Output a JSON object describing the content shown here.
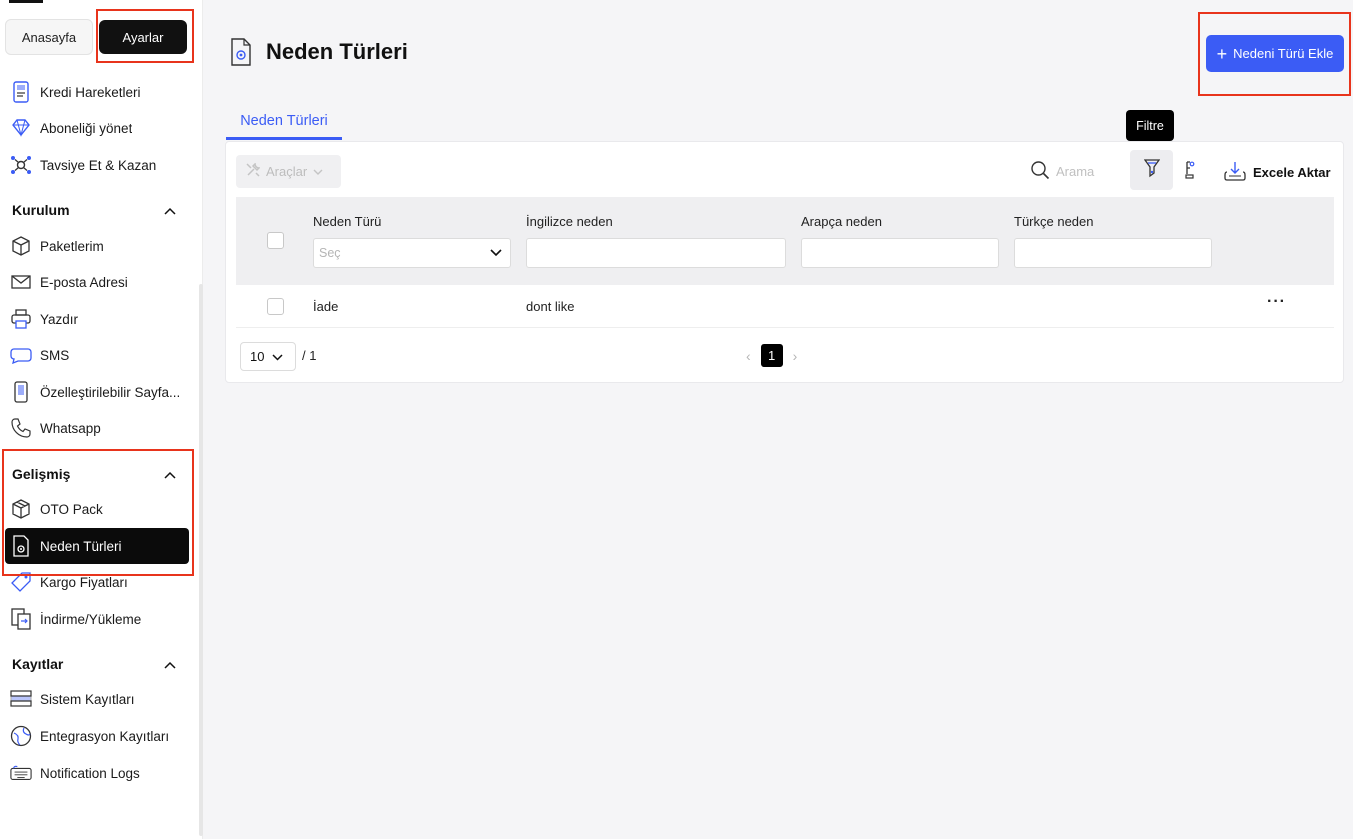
{
  "sidebar": {
    "home_label": "Anasayfa",
    "settings_label": "Ayarlar",
    "top_items": [
      {
        "label": "Kredi Hareketleri",
        "icon": "credit-card-icon"
      },
      {
        "label": "Aboneliği yönet",
        "icon": "diamond-icon"
      },
      {
        "label": "Tavsiye Et & Kazan",
        "icon": "network-icon"
      }
    ],
    "sections": [
      {
        "title": "Kurulum",
        "items": [
          {
            "label": "Paketlerim",
            "icon": "box-icon"
          },
          {
            "label": "E-posta Adresi",
            "icon": "mail-icon"
          },
          {
            "label": "Yazdır",
            "icon": "printer-icon"
          },
          {
            "label": "SMS",
            "icon": "chat-icon"
          },
          {
            "label": "Özelleştirilebilir Sayfa...",
            "icon": "phone-page-icon"
          },
          {
            "label": "Whatsapp",
            "icon": "phone-icon"
          }
        ]
      },
      {
        "title": "Gelişmiş",
        "items": [
          {
            "label": "OTO Pack",
            "icon": "package-icon"
          },
          {
            "label": "Neden Türleri",
            "icon": "document-gear-icon",
            "active": true
          },
          {
            "label": "Kargo Fiyatları",
            "icon": "tag-icon"
          },
          {
            "label": "İndirme/Yükleme",
            "icon": "transfer-icon"
          }
        ]
      },
      {
        "title": "Kayıtlar",
        "items": [
          {
            "label": "Sistem Kayıtları",
            "icon": "server-icon"
          },
          {
            "label": "Entegrasyon Kayıtları",
            "icon": "globe-icon"
          },
          {
            "label": "Notification Logs",
            "icon": "keyboard-icon"
          }
        ]
      }
    ]
  },
  "header": {
    "title": "Neden Türleri",
    "add_button": "Nedeni Türü Ekle"
  },
  "tabs": [
    {
      "label": "Neden Türleri"
    }
  ],
  "toolbar": {
    "tools_label": "Araçlar",
    "search_placeholder": "Arama",
    "filter_tooltip": "Filtre",
    "excel_label": "Excele Aktar"
  },
  "table": {
    "columns": [
      "Neden Türü",
      "İngilizce neden",
      "Arapça neden",
      "Türkçe neden"
    ],
    "select_placeholder": "Seç",
    "rows": [
      {
        "type": "İade",
        "english": "dont like",
        "arabic": "",
        "turkish": ""
      }
    ]
  },
  "pagination": {
    "page_size": "10",
    "total": "/ 1",
    "current_page": "1"
  },
  "colors": {
    "accent": "#3b5cf5",
    "highlight": "#e8341c",
    "active_bg": "#0b0b0b"
  }
}
